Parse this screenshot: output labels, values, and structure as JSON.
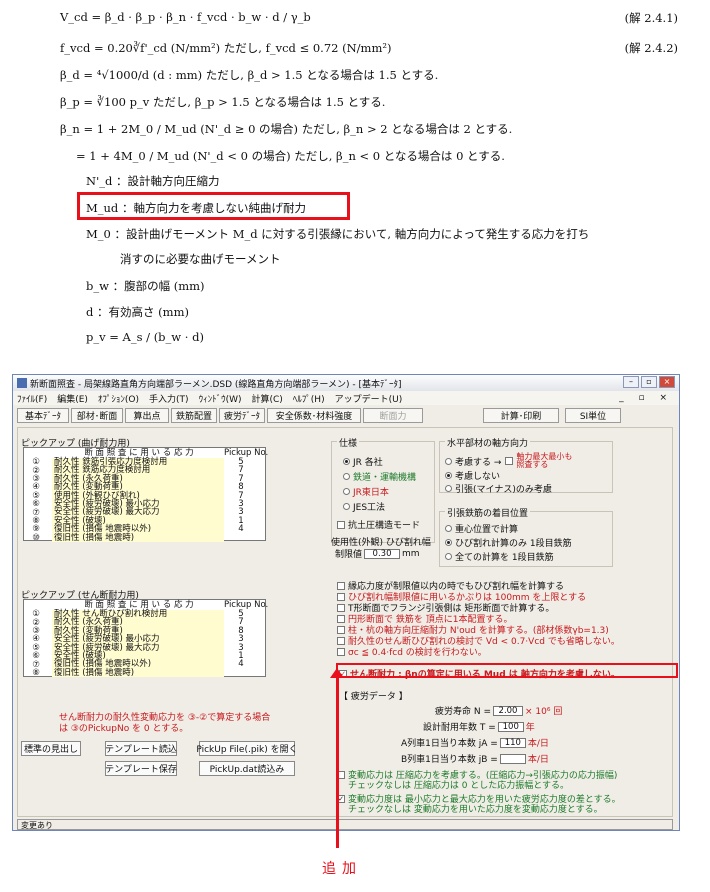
{
  "doc": {
    "eq1": "V_cd = β_d · β_p · β_n · f_vcd · b_w · d / γ_b",
    "eq1_no": "(解 2.4.1)",
    "eq2": "f_vcd = 0.20∛f'_cd   (N/mm²)  ただし, f_vcd ≤ 0.72 (N/mm²)",
    "eq2_no": "(解 2.4.2)",
    "eq3": "β_d = ⁴√1000/d   (d : mm)     ただし, β_d > 1.5 となる場合は 1.5 とする.",
    "eq4": "β_p = ∛100 p_v              ただし, β_p > 1.5 となる場合は 1.5 とする.",
    "eq5": "β_n = 1 + 2M_0 / M_ud  (N'_d ≥ 0 の場合)     ただし, β_n > 2 となる場合は 2 とする.",
    "eq6": "= 1 + 4M_0 / M_ud  (N'_d < 0 の場合)     ただし, β_n < 0 となる場合は 0 とする.",
    "def1": "N'_d ：設計軸方向圧縮力",
    "def2": "M_ud ：軸方向力を考慮しない純曲げ耐力",
    "def3a": "M_0 ：設計曲げモーメント M_d に対する引張縁において, 軸方向力によって発生する応力を打ち",
    "def3b": "消すのに必要な曲げモーメント",
    "def4": "b_w ：腹部の幅 (mm)",
    "def5": "d ：有効高さ (mm)",
    "def6": "p_v = A_s / (b_w · d)"
  },
  "window": {
    "title": "新断面照査 - 局架線路直角方向端部ラーメン.DSD (線路直角方向端部ラーメン) - [基本ﾃﾞｰﾀ]",
    "menu": [
      "ﾌｧｲﾙ(F)",
      "編集(E)",
      "ｵﾌﾟｼｮﾝ(O)",
      "手入力(T)",
      "ｳｨﾝﾄﾞｳ(W)",
      "計算(C)",
      "ﾍﾙﾌﾟ(H)",
      "アップデート(U)"
    ],
    "menu_right": "_ ▫ ×",
    "tabs": [
      "基本ﾃﾞｰﾀ",
      "部材･断面",
      "算出点",
      "鉄筋配置",
      "疲労ﾃﾞｰﾀ",
      "安全係数･材料強度",
      "断面力",
      "計算･印刷",
      "SI単位"
    ]
  },
  "pick1": {
    "title": "ピックアップ (曲げ耐力用)",
    "hdr": "断 面 照 査 に 用 い る 応 力",
    "hdr_pk": "Pickup No.",
    "rows": [
      {
        "n": "①",
        "t": "耐久性 鉄筋引張応力度検討用",
        "p": "5"
      },
      {
        "n": "②",
        "t": "耐久性 鉄筋応力度検討用",
        "p": "7"
      },
      {
        "n": "③",
        "t": "耐久性 (永久荷重)",
        "p": "7"
      },
      {
        "n": "④",
        "t": "耐久性 (変動荷重)",
        "p": "8"
      },
      {
        "n": "⑤",
        "t": "使用性 (外観ひび割れ)",
        "p": "7"
      },
      {
        "n": "⑥",
        "t": "安全性 (疲労破壊) 最小応力",
        "p": "3"
      },
      {
        "n": "⑦",
        "t": "安全性 (疲労破壊) 最大応力",
        "p": "3"
      },
      {
        "n": "⑧",
        "t": "安全性 (破壊)",
        "p": "1"
      },
      {
        "n": "⑨",
        "t": "復旧性 (損傷 地震時以外)",
        "p": "4"
      },
      {
        "n": "⑩",
        "t": "復旧性 (損傷 地震時)",
        "p": ""
      }
    ]
  },
  "pick2": {
    "title": "ピックアップ (せん断耐力用)",
    "hdr": "断 面 照 査 に 用 い る 応 力",
    "hdr_pk": "Pickup No.",
    "rows": [
      {
        "n": "①",
        "t": "耐久性 せん断ひび割れ検討用",
        "p": "5"
      },
      {
        "n": "②",
        "t": "耐久性 (永久荷重)",
        "p": "7"
      },
      {
        "n": "③",
        "t": "耐久性 (変動荷重)",
        "p": "8"
      },
      {
        "n": "④",
        "t": "安全性 (疲労破壊) 最小応力",
        "p": "3"
      },
      {
        "n": "⑤",
        "t": "安全性 (疲労破壊) 最大応力",
        "p": "3"
      },
      {
        "n": "⑥",
        "t": "安全性 (破壊)",
        "p": "1"
      },
      {
        "n": "⑦",
        "t": "復旧性 (損傷 地震時以外)",
        "p": "4"
      },
      {
        "n": "⑧",
        "t": "復旧性 (損傷 地震時)",
        "p": ""
      }
    ]
  },
  "note": "せん断耐力の耐久性変動応力を ③-②で算定する場合は ③のPickupNo を 0 とする。",
  "buttons": {
    "standard": "標準の見出し",
    "tpl_load": "テンプレート読込",
    "pickup_open": "PickUp File(.pik) を開く",
    "tpl_save": "テンプレート保存",
    "pickup_dat": "PickUp.dat読込み"
  },
  "status": "変更あり",
  "spec": {
    "title": "仕様",
    "opts": [
      "JR 各社",
      "鉄道・運輸機構",
      "JR東日本",
      "JES工法"
    ],
    "sel": 0,
    "check": "抗土圧構造モード",
    "crack_label": "使用性(外観) ひび割れ幅",
    "limit_label": "制限値",
    "limit_value": "0.30",
    "limit_unit": "mm"
  },
  "axial": {
    "title": "水平部材の軸方向力",
    "opt1": "考慮する →",
    "sub": "軸力最大最小も照査する",
    "opt2": "考慮しない",
    "opt3": "引張(マイナス)のみ考慮"
  },
  "rebar": {
    "title": "引張鉄筋の着目位置",
    "opts": [
      "重心位置で計算",
      "ひび割れ計算のみ 1段目鉄筋",
      "全ての計算を 1段目鉄筋"
    ],
    "sel": 1
  },
  "checks": [
    {
      "t": "縁応力度が制限値以内の時でもひび割れ幅を計算する",
      "on": false,
      "red": false
    },
    {
      "t": "ひび割れ幅制限値に用いるかぶりは 100mm を上限とする",
      "on": false,
      "red": true
    },
    {
      "t": "T形断面でフランジ引張側は 矩形断面で計算する。",
      "on": false,
      "red": false
    },
    {
      "t": "円形断面で 鉄筋を 頂点に1本配置する。",
      "on": false,
      "red": true
    },
    {
      "t": "柱・杭の軸方向圧縮耐力 N'oud を計算する。(部材係数γb=1.3)",
      "on": false,
      "red": true
    },
    {
      "t": "耐久性のせん断ひび割れの検討で Vd < 0.7·Vcd でも省略しない。",
      "on": false,
      "red": true
    },
    {
      "t": "σc ≦ 0.4·fcd の検討を行わない。",
      "on": false,
      "red": true
    },
    {
      "t": "せん断耐力 : βnの算定に用いる Mud は 軸方向力を考慮しない。",
      "on": true,
      "red": true
    }
  ],
  "fatigue": {
    "title": "【 疲労データ 】",
    "life_label": "疲労寿命 N =",
    "life_value": "2.00",
    "life_unit": "× 10⁶ 回",
    "years_label": "設計耐用年数 T =",
    "years_value": "100",
    "years_unit": "年",
    "a_label": "A列車1日当り本数 jA =",
    "a_value": "110",
    "a_unit": "本/日",
    "b_label": "B列車1日当り本数 jB =",
    "b_value": "",
    "b_unit": "本/日"
  },
  "bottomchecks": [
    {
      "t1": "変動応力は 圧縮応力を考慮する。(圧縮応力→引張応力の応力振幅)",
      "t2": "チェックなしは 圧縮応力は 0 とした応力振幅とする。",
      "on": false
    },
    {
      "t1": "変動応力度は 最小応力と最大応力を用いた疲労応力度の差とする。",
      "t2": "チェックなしは 変動応力を用いた応力度を変動応力度とする。",
      "on": true
    }
  ],
  "calc_btn": "計算･印刷",
  "si_btn": "SI単位",
  "caption": "追加"
}
